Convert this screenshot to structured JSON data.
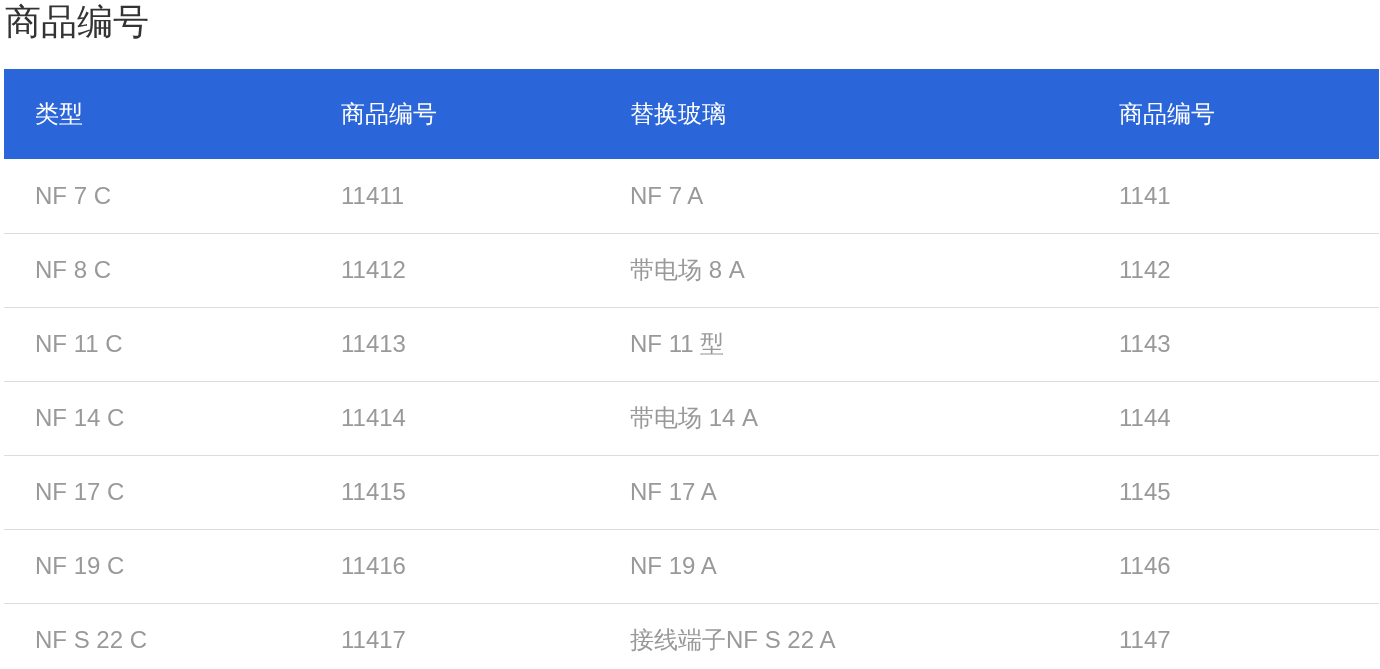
{
  "title": "商品编号",
  "table": {
    "columns": [
      "类型",
      "商品编号",
      "替换玻璃",
      "商品编号"
    ],
    "rows": [
      [
        "NF 7 C",
        "11411",
        "NF 7 A",
        "1141"
      ],
      [
        "NF 8 C",
        "11412",
        "带电场 8 A",
        "1142"
      ],
      [
        "NF 11 C",
        "11413",
        "NF 11 型",
        "1143"
      ],
      [
        "NF 14 C",
        "11414",
        "带电场 14 A",
        "1144"
      ],
      [
        "NF 17 C",
        "11415",
        "NF 17 A",
        "1145"
      ],
      [
        "NF 19 C",
        "11416",
        "NF 19 A",
        "1146"
      ],
      [
        "NF S 22 C",
        "11417",
        "接线端子NF S 22 A",
        "1147"
      ]
    ]
  }
}
